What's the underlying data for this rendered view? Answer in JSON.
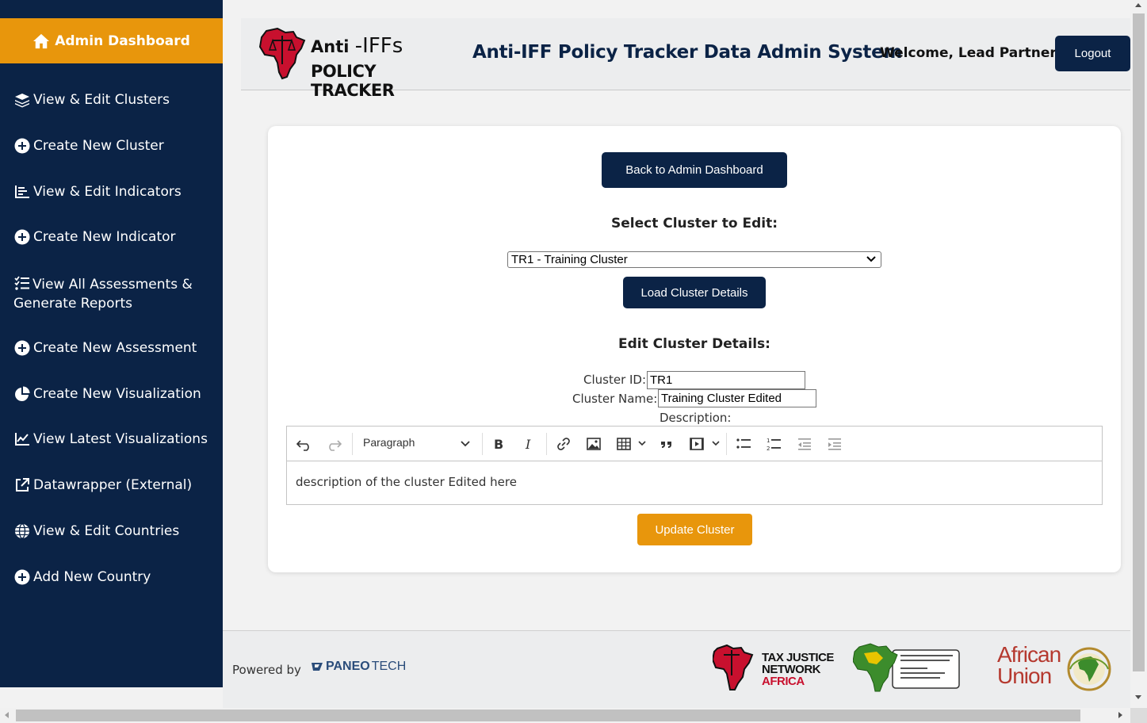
{
  "sidebar": {
    "admin_dashboard": "Admin Dashboard",
    "items": [
      {
        "label": "View & Edit Clusters",
        "icon": "layers-icon"
      },
      {
        "label": "Create New Cluster",
        "icon": "plus-circle-icon"
      },
      {
        "label": "View & Edit Indicators",
        "icon": "chart-list-icon"
      },
      {
        "label": "Create New Indicator",
        "icon": "plus-circle-icon"
      },
      {
        "label": "View All Assessments & Generate Reports",
        "icon": "checklist-icon"
      },
      {
        "label": "Create New Assessment",
        "icon": "plus-circle-icon"
      },
      {
        "label": "Create New Visualization",
        "icon": "pie-chart-icon"
      },
      {
        "label": "View Latest Visualizations",
        "icon": "line-chart-icon"
      },
      {
        "label": "Datawrapper (External)",
        "icon": "external-link-icon"
      },
      {
        "label": "View & Edit Countries",
        "icon": "globe-icon"
      },
      {
        "label": "Add New Country",
        "icon": "plus-circle-icon"
      }
    ]
  },
  "header": {
    "logo_line1_a": "Anti",
    "logo_line1_b": "-IFFs",
    "logo_line2": "POLICY TRACKER",
    "title": "Anti-IFF Policy Tracker Data Admin System",
    "welcome": "Welcome, Lead Partner!",
    "logout": "Logout"
  },
  "main": {
    "back_button": "Back to Admin Dashboard",
    "select_label": "Select Cluster to Edit:",
    "selected_cluster": "TR1 - Training Cluster",
    "load_button": "Load Cluster Details",
    "edit_heading": "Edit Cluster Details:",
    "cluster_id_label": "Cluster ID:",
    "cluster_id_value": "TR1",
    "cluster_name_label": "Cluster Name:",
    "cluster_name_value": "Training Cluster Edited",
    "description_label": "Description:",
    "editor": {
      "block_format": "Paragraph",
      "content": "description of the cluster Edited here"
    },
    "update_button": "Update Cluster"
  },
  "footer": {
    "powered_by": "Powered by",
    "paneo_a": "PANEO",
    "paneo_b": "TECH",
    "tjn_line1": "TAX JUSTICE",
    "tjn_line2": "NETWORK",
    "tjn_line3": "AFRICA",
    "au_line1": "African",
    "au_line2": "Union"
  },
  "colors": {
    "navy": "#0b2346",
    "orange": "#e8960c",
    "africa_red": "#c8102e"
  }
}
